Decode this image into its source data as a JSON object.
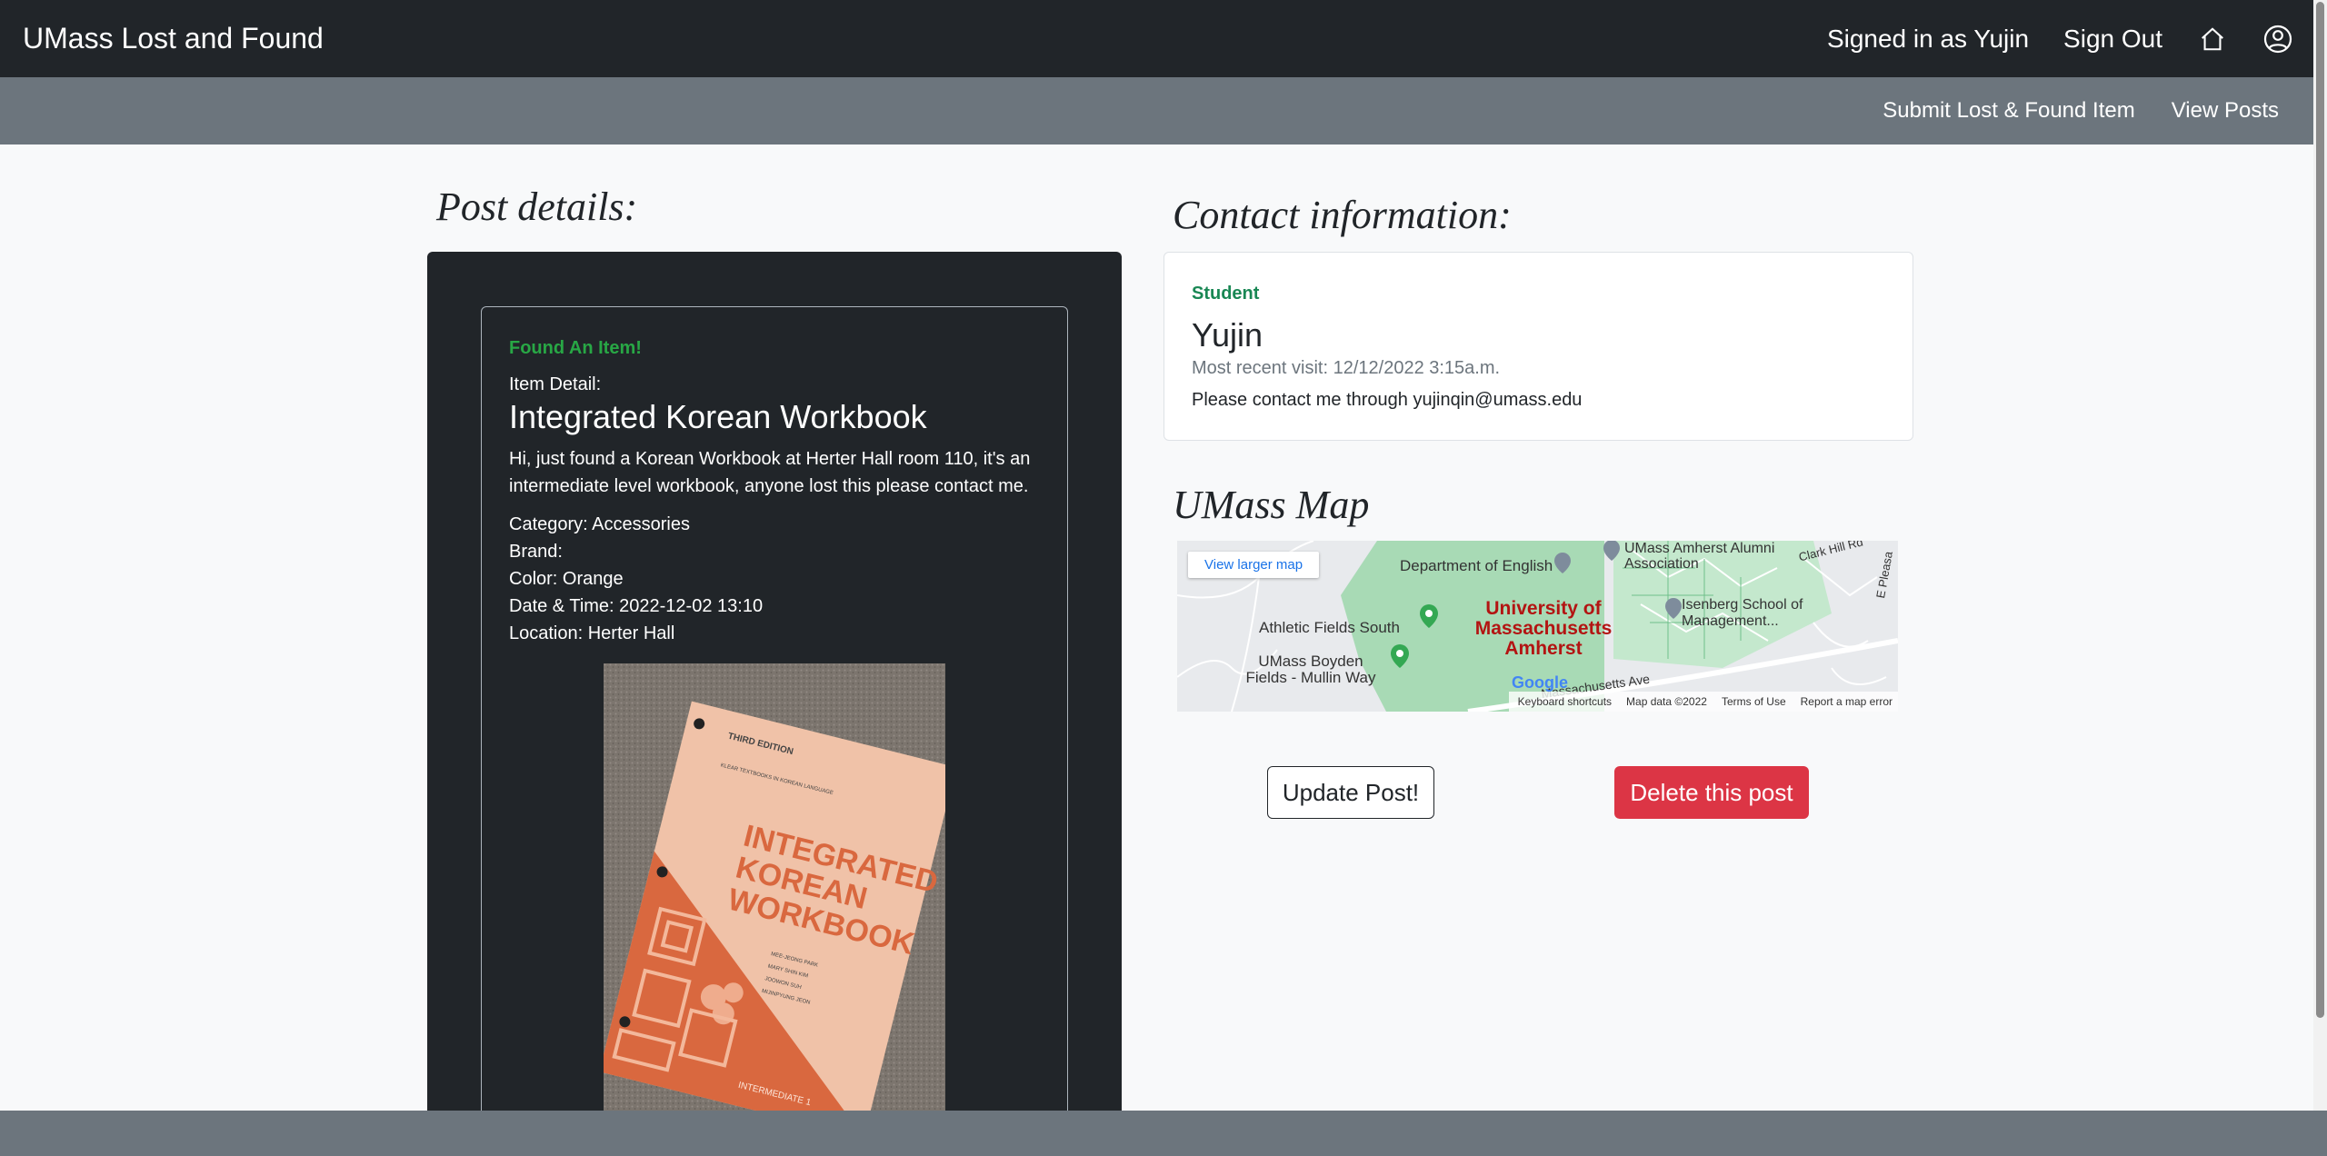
{
  "nav": {
    "brand": "UMass Lost and Found",
    "signed_in": "Signed in as Yujin",
    "sign_out": "Sign Out",
    "home_icon": "home-icon",
    "profile_icon": "person-circle-icon"
  },
  "subnav": {
    "submit": "Submit Lost & Found Item",
    "view_posts": "View Posts"
  },
  "post": {
    "heading": "Post details:",
    "status": "Found An Item!",
    "detail_label": "Item Detail:",
    "title": "Integrated Korean Workbook",
    "description": "Hi, just found a Korean Workbook at Herter Hall room 110, it's an intermediate level workbook, anyone lost this please contact me.",
    "category": "Category: Accessories",
    "brand": "Brand:",
    "color": "Color: Orange",
    "datetime": "Date & Time: 2022-12-02 13:10",
    "location": "Location: Herter Hall",
    "book": {
      "edition": "THIRD EDITION",
      "subtitle": "KLEAR TEXTBOOKS IN KOREAN LANGUAGE",
      "title_lines": [
        "INTEGRATED",
        "KOREAN",
        "WORKBOOK"
      ],
      "authors": [
        "MEE-JEONG PARK",
        "MARY SHIN KIM",
        "JOOWON SUH",
        "MIJINPYUNG JEON"
      ],
      "level": "INTERMEDIATE 1"
    }
  },
  "contact": {
    "heading": "Contact information:",
    "role": "Student",
    "name": "Yujin",
    "visit": "Most recent visit: 12/12/2022 3:15a.m.",
    "note": "Please contact me through yujinqin@umass.edu"
  },
  "map": {
    "heading": "UMass Map",
    "larger": "View larger map",
    "labels": {
      "english": "Department of English",
      "alumni": "UMass Amherst Alumni Association",
      "isenberg": "Isenberg School of Management...",
      "athletic": "Athletic Fields South",
      "boyden": "UMass Boyden Fields - Mullin Way",
      "university": "University of Massachusetts Amherst",
      "clark": "Clark Hill Rd",
      "pleasant": "E Pleasa",
      "avenue": "Massachusetts Ave"
    },
    "google": "Google",
    "footer": {
      "shortcuts": "Keyboard shortcuts",
      "mapdata": "Map data ©2022",
      "terms": "Terms of Use",
      "report": "Report a map error"
    }
  },
  "actions": {
    "update": "Update Post!",
    "delete": "Delete this post"
  }
}
